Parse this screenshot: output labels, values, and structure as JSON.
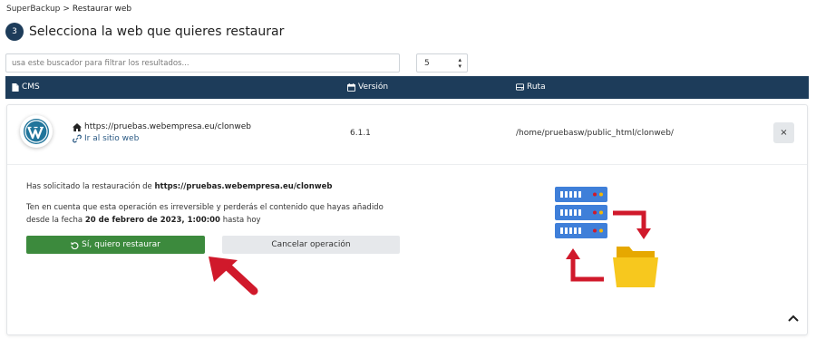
{
  "breadcrumb": {
    "root": "SuperBackup",
    "separator": ">",
    "current": "Restaurar web"
  },
  "step": {
    "number": "3",
    "title": "Selecciona la web que quieres restaurar"
  },
  "search": {
    "placeholder": "usa este buscador para filtrar los resultados...",
    "value": ""
  },
  "page_size": {
    "selected": "5"
  },
  "table": {
    "headers": {
      "cms": "CMS",
      "version": "Versión",
      "path": "Ruta"
    }
  },
  "site": {
    "url": "https://pruebas.webempresa.eu/clonweb",
    "link_label": "Ir al sitio web",
    "version": "6.1.1",
    "path": "/home/pruebasw/public_html/clonweb/",
    "close_label": "×"
  },
  "confirm": {
    "line1_prefix": "Has solicitado la restauración de",
    "line1_url": "https://pruebas.webempresa.eu/clonweb",
    "line2_prefix": "Ten en cuenta que esta operación es irreversible y perderás el contenido que hayas añadido desde la fecha",
    "line2_date": "20 de febrero de 2023, 1:00:00",
    "line2_suffix": "hasta hoy",
    "restore_label": "Sí, quiero restaurar",
    "cancel_label": "Cancelar operación"
  },
  "colors": {
    "header_bg": "#1d3c5a",
    "restore_bg": "#3c8a3d",
    "cancel_bg": "#e6e8eb",
    "server_blue": "#3f7fd9",
    "arrow_red": "#d0192b",
    "folder_yellow": "#f2b705"
  },
  "icons": {
    "file": "file-icon",
    "calendar": "calendar-icon",
    "path": "hdd-icon",
    "home": "home-icon",
    "link": "link-icon",
    "undo": "undo-icon",
    "collapse": "chevron-up-icon"
  }
}
